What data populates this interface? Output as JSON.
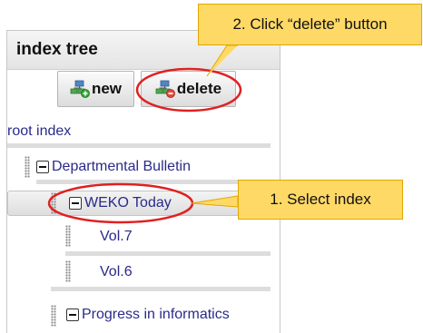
{
  "panel": {
    "title": "index tree"
  },
  "toolbar": {
    "new_label": "new",
    "delete_label": "delete"
  },
  "tree": {
    "root_label": "root index",
    "items": [
      {
        "label": "Departmental Bulletin"
      },
      {
        "label": "WEKO Today"
      },
      {
        "label": "Vol.7"
      },
      {
        "label": "Vol.6"
      },
      {
        "label": "Progress in informatics"
      }
    ]
  },
  "annotations": {
    "step1": "1. Select index",
    "step2": "2. Click “delete” button"
  },
  "colors": {
    "callout_fill": "#ffd966",
    "highlight_ring": "#e02020",
    "link_text": "#2a2a8a"
  }
}
